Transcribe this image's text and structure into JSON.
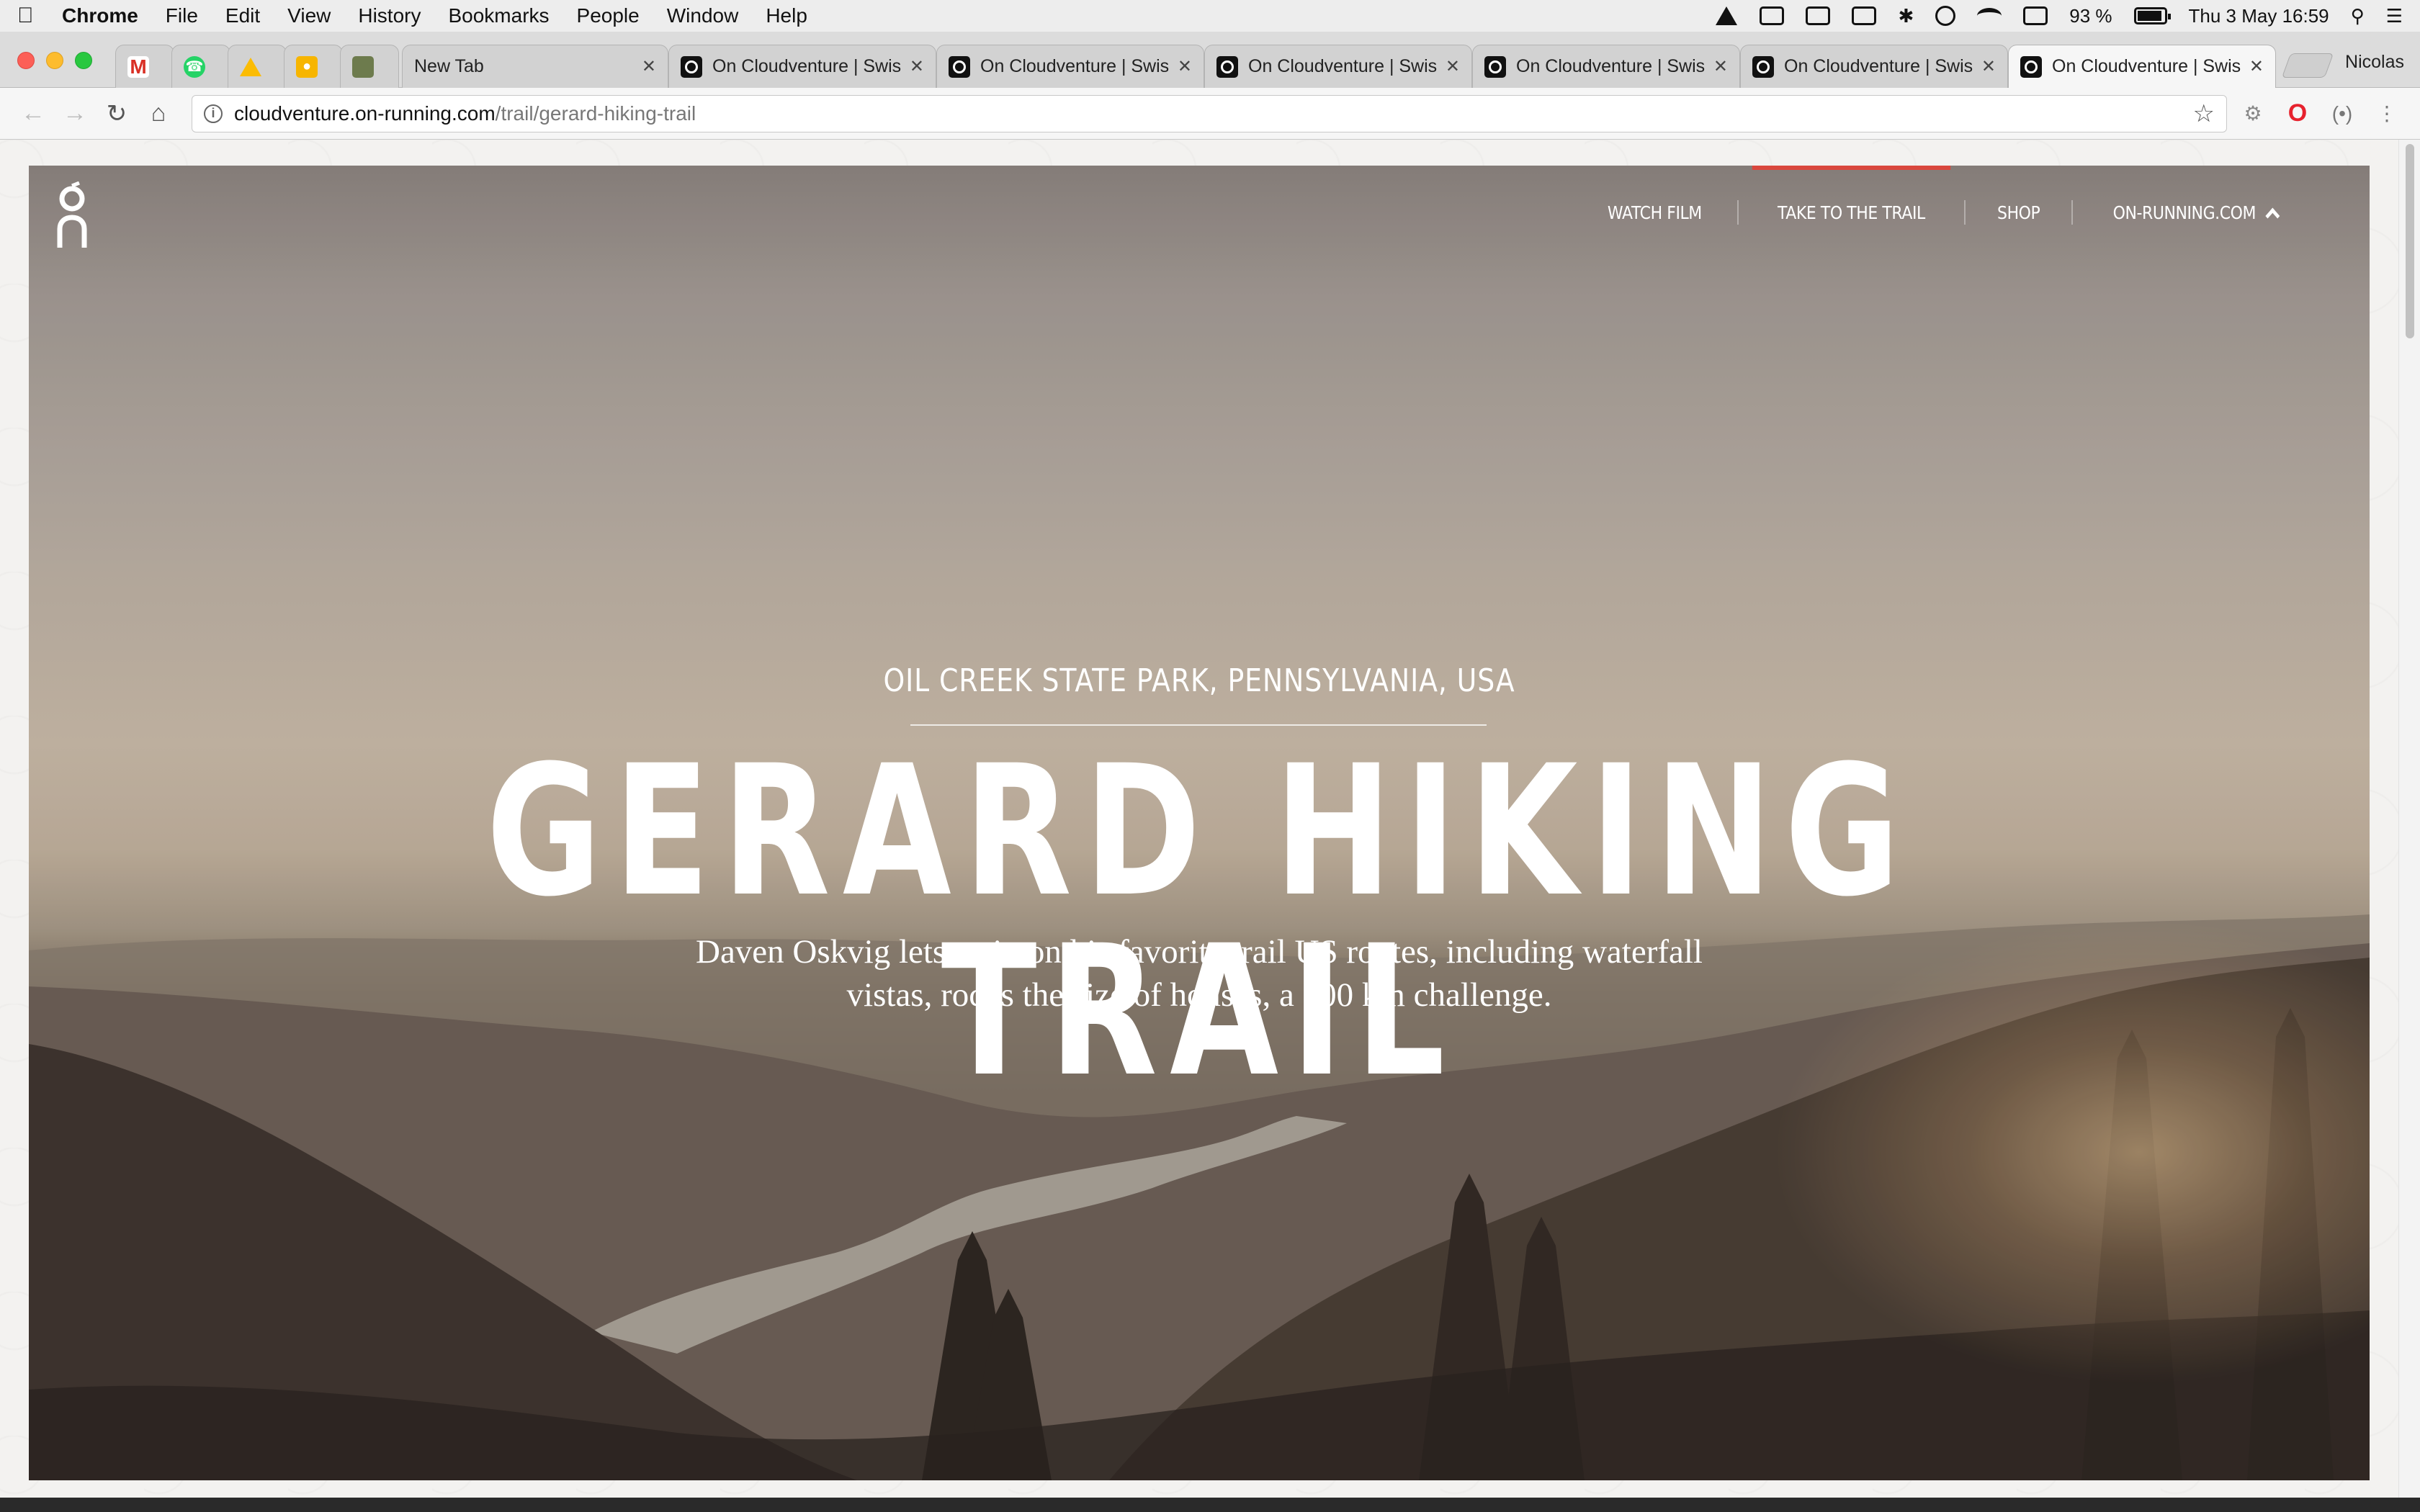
{
  "menubar": {
    "app_name": "Chrome",
    "menus": [
      "File",
      "Edit",
      "View",
      "History",
      "Bookmarks",
      "People",
      "Window",
      "Help"
    ],
    "battery": "93 %",
    "datetime": "Thu 3 May  16:59"
  },
  "tabs": [
    {
      "title": "",
      "favicon": "gmail-icon"
    },
    {
      "title": "",
      "favicon": "whatsapp-icon"
    },
    {
      "title": "",
      "favicon": "google-drive-icon"
    },
    {
      "title": "",
      "favicon": "google-keep-icon"
    },
    {
      "title": "",
      "favicon": "photo-icon"
    },
    {
      "title": "New Tab",
      "favicon": ""
    },
    {
      "title": "On Cloudventure | Swis",
      "favicon": "on-icon"
    },
    {
      "title": "On Cloudventure | Swis",
      "favicon": "on-icon"
    },
    {
      "title": "On Cloudventure | Swis",
      "favicon": "on-icon"
    },
    {
      "title": "On Cloudventure | Swis",
      "favicon": "on-icon"
    },
    {
      "title": "On Cloudventure | Swis",
      "favicon": "on-icon"
    },
    {
      "title": "On Cloudventure | Swis",
      "favicon": "on-icon",
      "active": true
    }
  ],
  "profile_name": "Nicolas",
  "address_bar": {
    "host": "cloudventure.on-running.com",
    "path": "/trail/gerard-hiking-trail"
  },
  "site": {
    "nav": {
      "watch_film": "WATCH FILM",
      "take_to_trail": "TAKE TO THE TRAIL",
      "shop": "SHOP",
      "on_running": "ON-RUNNING.COM"
    },
    "hero": {
      "location": "OIL CREEK STATE PARK, PENNSYLVANIA, USA",
      "title": "GERARD HIKING TRAIL",
      "description": "Daven Oskvig lets us in on his favorite trail US routes, including waterfall vistas, rocks the size of houses, a 100 km challenge."
    }
  },
  "colors": {
    "nav_active_accent": "#d9473d",
    "hero_text": "#ffffff"
  }
}
